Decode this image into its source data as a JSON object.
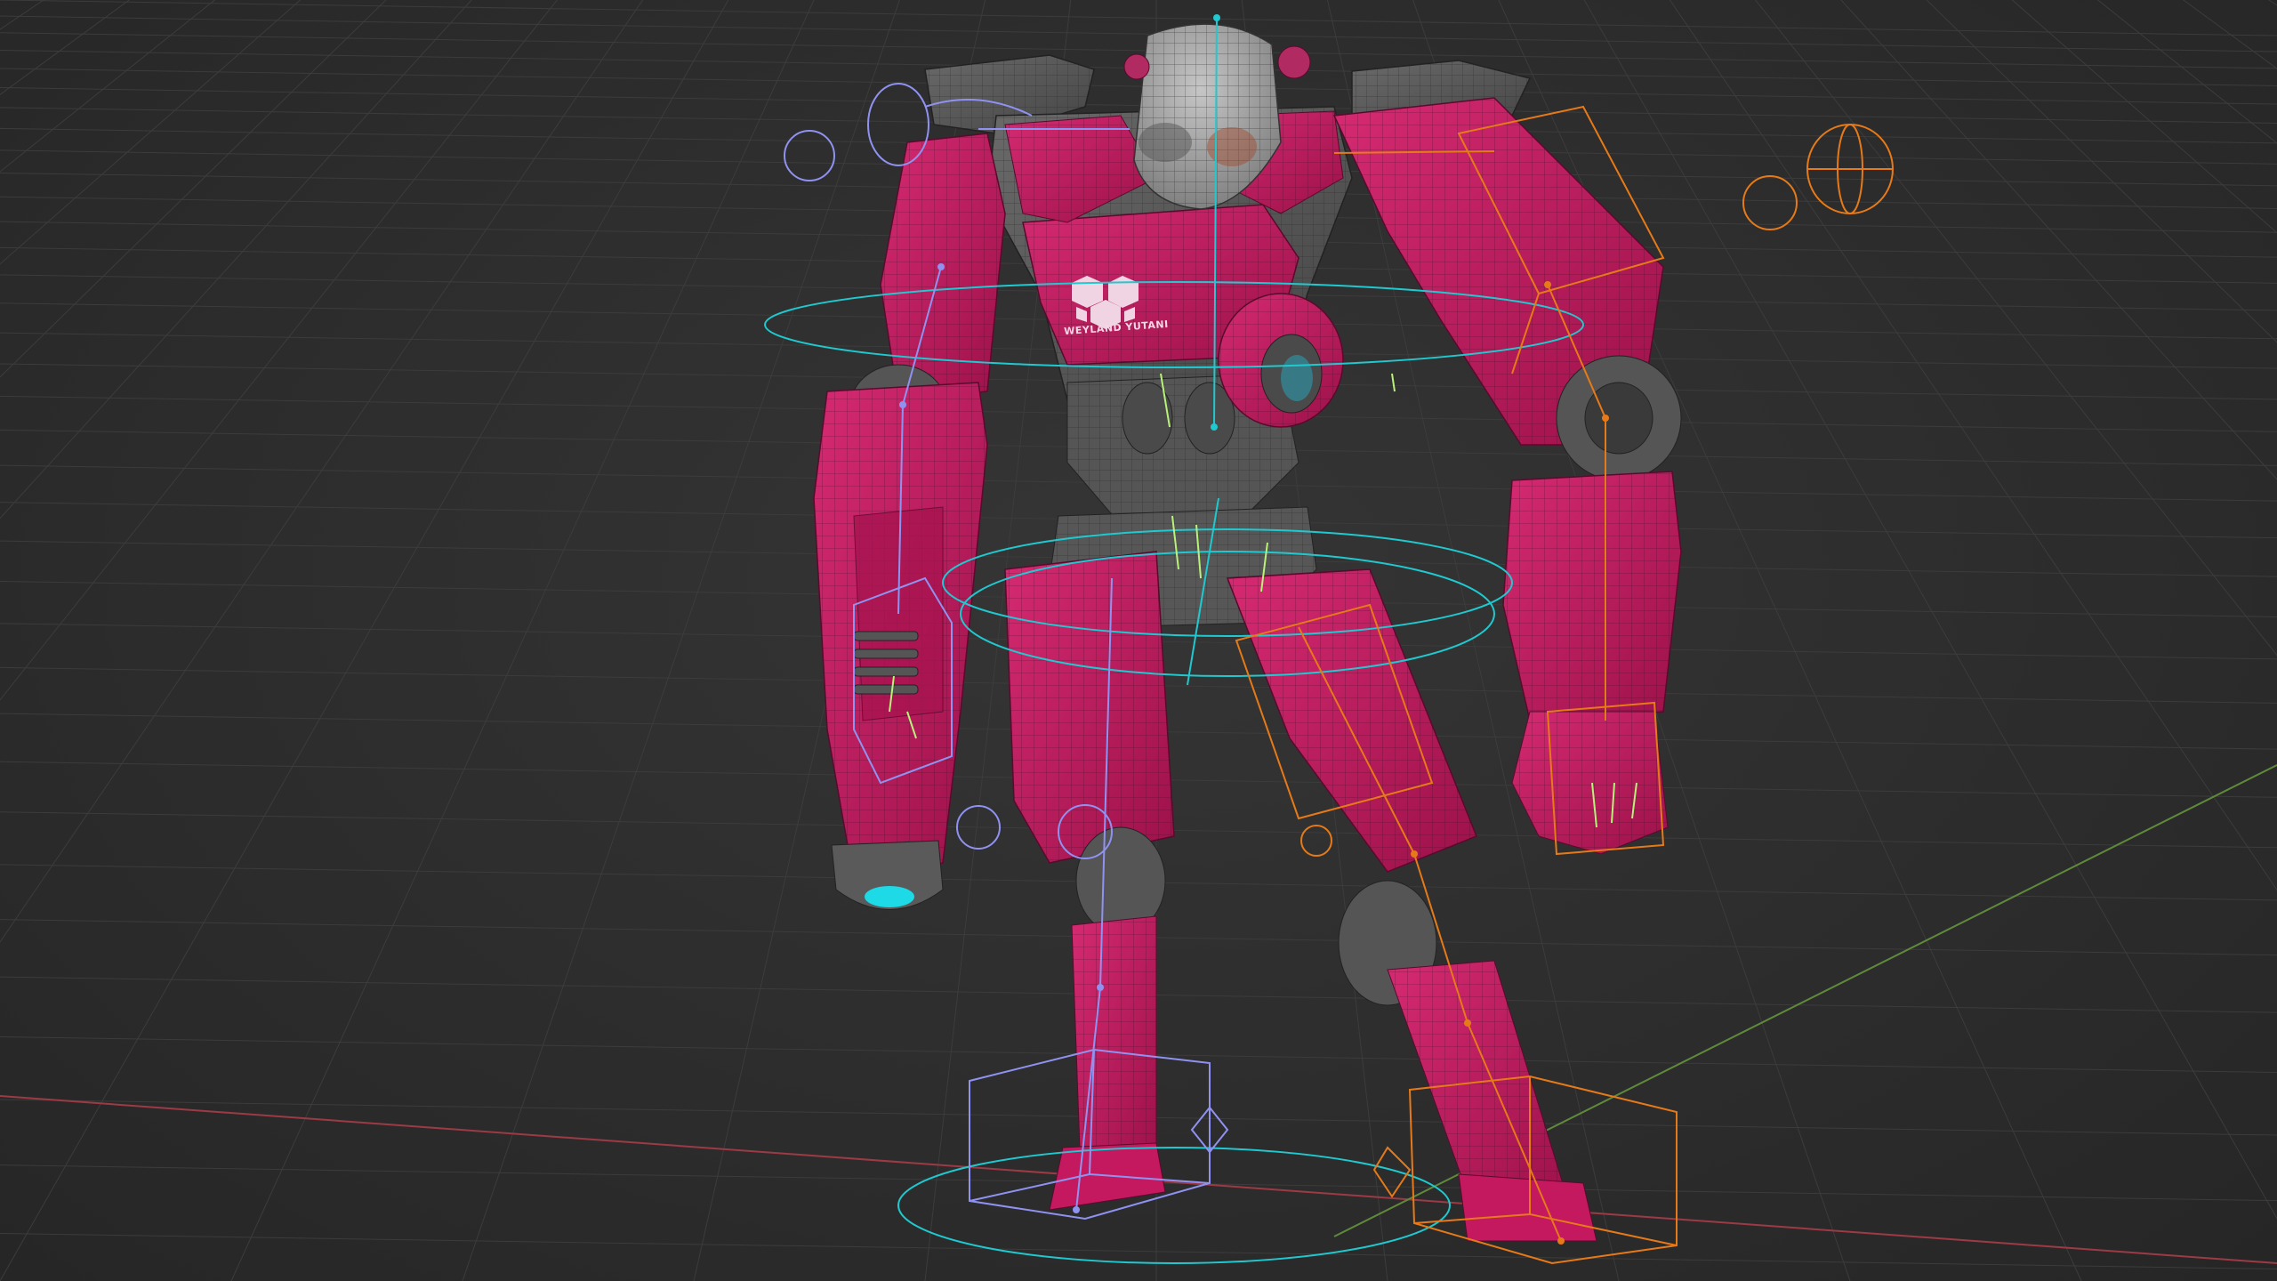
{
  "viewport": {
    "mode": "3d-viewport",
    "shading": "wireframe-overlay-on-solid",
    "background_color": "#2e2e2e"
  },
  "model": {
    "object": "mech-robot",
    "chest_logo_text": "WEYLAND YUTANI",
    "colors": {
      "armor": "#c4195f",
      "armor_dark": "#8e0f44",
      "metal": "#5d5d5d",
      "head": "#9a9a9a",
      "glow": "#1ed9e6"
    }
  },
  "rig": {
    "colors": {
      "left_side": "#8f92f0",
      "right_side": "#e67a18",
      "center": "#1fc9cf",
      "finger_bones": "#b8f27a"
    }
  },
  "axes": {
    "x_axis_color": "#9c3a46",
    "y_axis_color": "#5f8a3c"
  }
}
